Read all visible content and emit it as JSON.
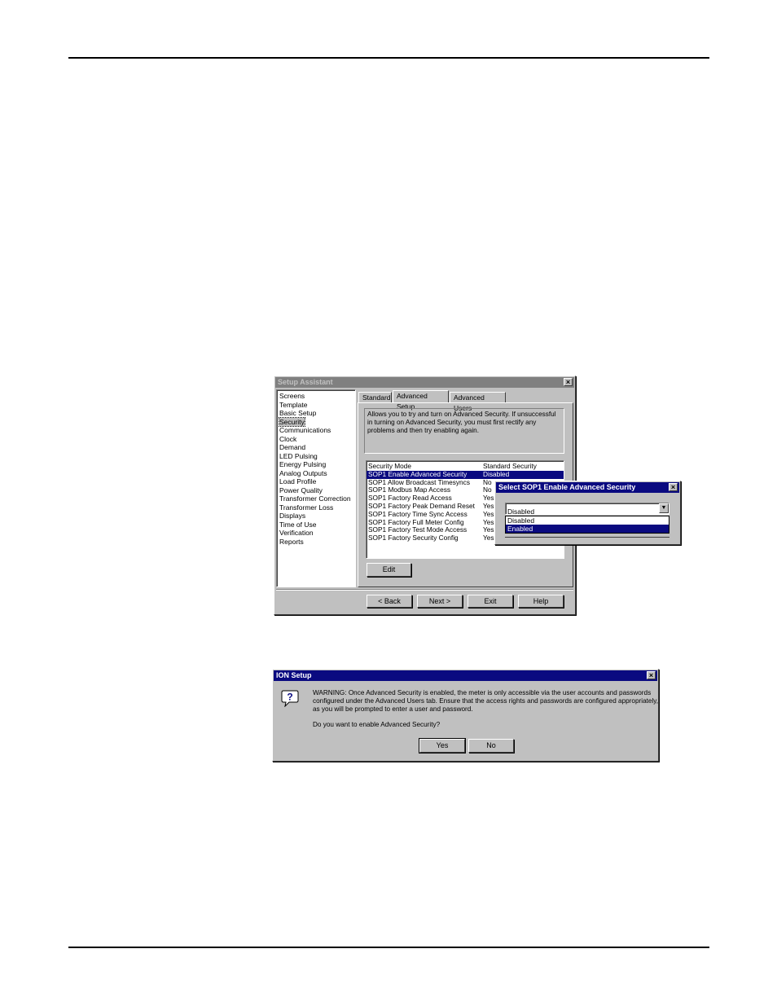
{
  "setup_assistant": {
    "title": "Setup Assistant",
    "nav_items": [
      "Screens",
      "Template",
      "Basic Setup",
      "Security",
      "Communications",
      "Clock",
      "Demand",
      "LED Pulsing",
      "Energy Pulsing",
      "Analog Outputs",
      "Load Profile",
      "Power Quality",
      "Transformer Correction",
      "Transformer Loss",
      "Displays",
      "Time of Use",
      "Verification",
      "Reports"
    ],
    "selected_nav": "Security",
    "tabs": [
      "Standard",
      "Advanced Setup",
      "Advanced Users"
    ],
    "active_tab": "Advanced Setup",
    "description": "Allows you to try and turn on Advanced Security.  If unsuccessful in turning on Advanced Security, you must first rectify any problems and then try enabling again.",
    "params": [
      {
        "name": "Security Mode",
        "value": "Standard Security"
      },
      {
        "name": "SOP1 Enable Advanced Security",
        "value": "Disabled"
      },
      {
        "name": "SOP1 Allow Broadcast Timesyncs",
        "value": "No"
      },
      {
        "name": "SOP1 Modbus Map Access",
        "value": "No"
      },
      {
        "name": "SOP1 Factory Read Access",
        "value": "Yes"
      },
      {
        "name": "SOP1 Factory Peak Demand Reset",
        "value": "Yes"
      },
      {
        "name": "SOP1 Factory Time Sync Access",
        "value": "Yes"
      },
      {
        "name": "SOP1 Factory Full Meter Config",
        "value": "Yes"
      },
      {
        "name": "SOP1 Factory Test Mode Access",
        "value": "Yes"
      },
      {
        "name": "SOP1 Factory Security Config",
        "value": "Yes"
      }
    ],
    "selected_param": "SOP1 Enable Advanced Security",
    "edit_label": "Edit",
    "back_label": "< Back",
    "next_label": "Next >",
    "exit_label": "Exit",
    "help_label": "Help"
  },
  "select_dialog": {
    "title": "Select SOP1 Enable Advanced Security",
    "current_value": "Disabled",
    "options": [
      "Disabled",
      "Enabled"
    ],
    "highlighted_option": "Enabled"
  },
  "ion_dialog": {
    "title": "ION Setup",
    "warning": "WARNING: Once Advanced Security is enabled, the meter is only accessible via the user accounts and passwords configured under the Advanced Users tab.  Ensure that the access rights and passwords are configured appropriately, as you will be prompted to enter a user and password.",
    "question": "Do you want to enable Advanced Security?",
    "yes_label": "Yes",
    "no_label": "No"
  }
}
